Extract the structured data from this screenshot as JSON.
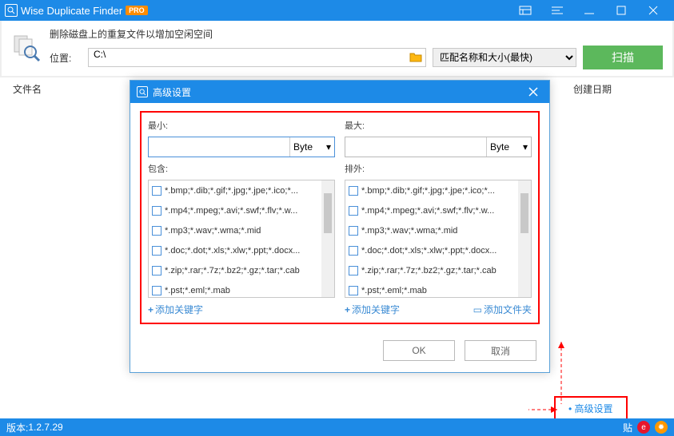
{
  "title": "Wise Duplicate Finder",
  "pro": "PRO",
  "header": {
    "desc": "删除磁盘上的重复文件以增加空闲空间",
    "location_label": "位置:",
    "location_value": "C:\\",
    "match_mode": "匹配名称和大小(最快)",
    "scan": "扫描"
  },
  "columns": {
    "name": "文件名",
    "created": "创建日期"
  },
  "dialog": {
    "title": "高级设置",
    "min_label": "最小:",
    "max_label": "最大:",
    "min_value": "",
    "max_value": "",
    "unit": "Byte",
    "include_label": "包含:",
    "exclude_label": "排外:",
    "items": [
      "*.bmp;*.dib;*.gif;*.jpg;*.jpe;*.ico;*...",
      "*.mp4;*.mpeg;*.avi;*.swf;*.flv;*.w...",
      "*.mp3;*.wav;*.wma;*.mid",
      "*.doc;*.dot;*.xls;*.xlw;*.ppt;*.docx...",
      "*.zip;*.rar;*.7z;*.bz2;*.gz;*.tar;*.cab",
      "*.pst;*.eml;*.mab"
    ],
    "add_keyword": "添加关键字",
    "add_folder": "添加文件夹",
    "ok": "OK",
    "cancel": "取消"
  },
  "adv_link": "高级设置",
  "status": {
    "version_label": "版本:",
    "version": "1.2.7.29",
    "tie": "贴"
  }
}
